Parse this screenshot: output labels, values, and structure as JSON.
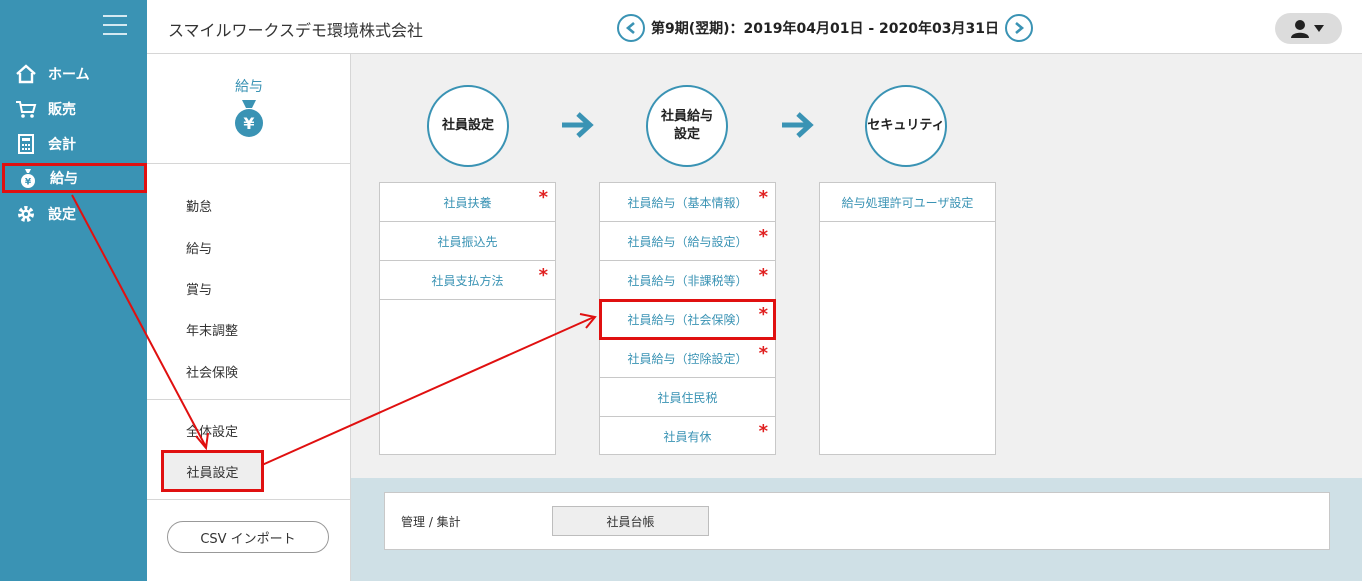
{
  "header": {
    "company": "スマイルワークスデモ環境株式会社",
    "period": "第9期(翌期)：2019年04月01日 - 2020年03月31日"
  },
  "nav": {
    "items": [
      {
        "label": "ホーム",
        "icon": "home-icon"
      },
      {
        "label": "販売",
        "icon": "cart-icon"
      },
      {
        "label": "会計",
        "icon": "calculator-icon"
      },
      {
        "label": "給与",
        "icon": "money-bag-icon"
      },
      {
        "label": "設定",
        "icon": "gear-icon"
      }
    ]
  },
  "submenu": {
    "title": "給与",
    "items": [
      "勤怠",
      "給与",
      "賞与",
      "年末調整",
      "社会保険",
      "全体設定"
    ],
    "selected": "社員設定",
    "csv_button": "CSV インポート"
  },
  "flow": {
    "steps": [
      "社員設定",
      "社員給与\n設定",
      "セキュリティ"
    ],
    "columns": [
      [
        {
          "label": "社員扶養",
          "required": true
        },
        {
          "label": "社員振込先",
          "required": false
        },
        {
          "label": "社員支払方法",
          "required": true
        }
      ],
      [
        {
          "label": "社員給与（基本情報）",
          "required": true
        },
        {
          "label": "社員給与（給与設定）",
          "required": true
        },
        {
          "label": "社員給与（非課税等）",
          "required": true
        },
        {
          "label": "社員給与（社会保険）",
          "required": true
        },
        {
          "label": "社員給与（控除設定）",
          "required": true
        },
        {
          "label": "社員住民税",
          "required": false
        },
        {
          "label": "社員有休",
          "required": true
        }
      ],
      [
        {
          "label": "給与処理許可ユーザ設定",
          "required": false
        }
      ]
    ],
    "required_mark": "*"
  },
  "management": {
    "label": "管理 / 集計",
    "button": "社員台帳"
  },
  "colors": {
    "accent": "#3a93b4",
    "highlight": "#e01010",
    "required": "#e02020"
  }
}
